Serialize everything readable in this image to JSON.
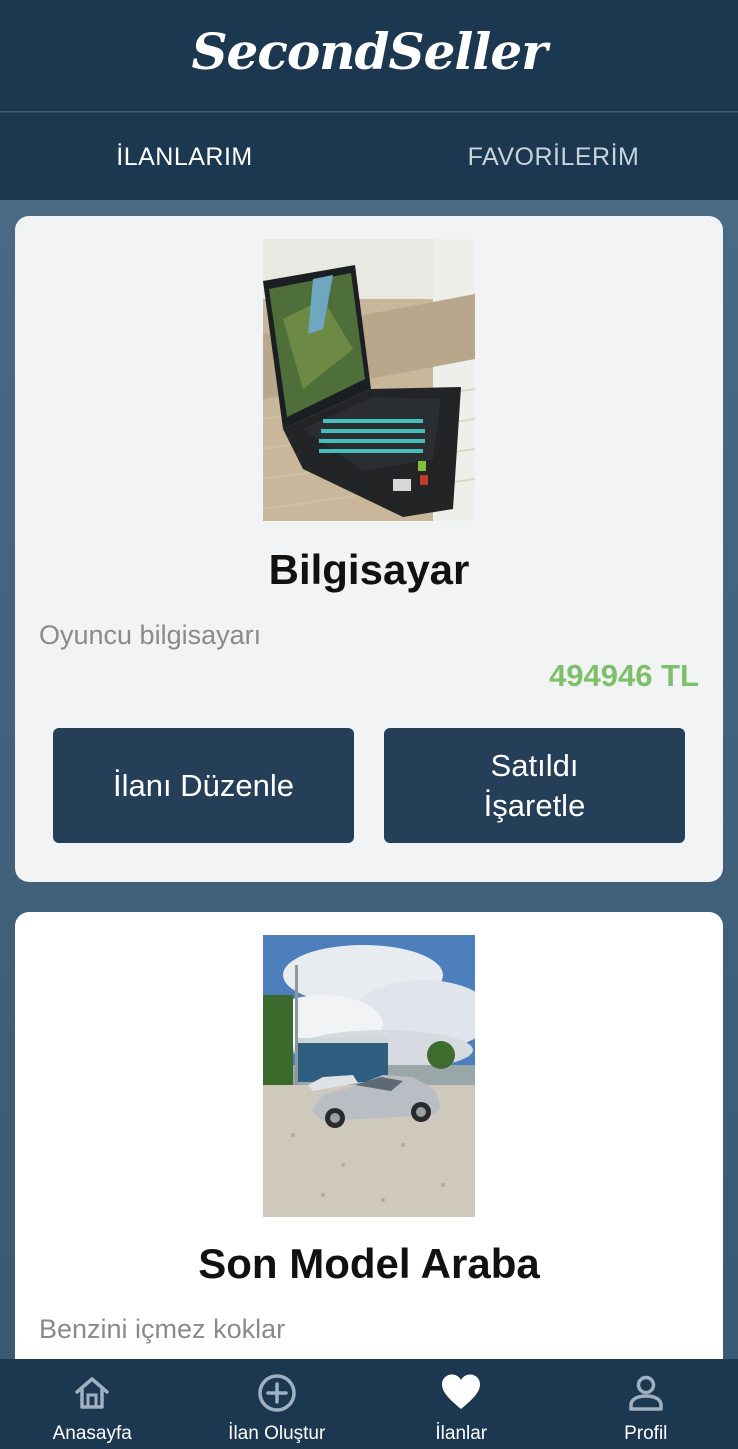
{
  "header": {
    "brand": "SecondSeller"
  },
  "tabs": [
    {
      "label": "İLANLARIM",
      "active": true
    },
    {
      "label": "FAVORİLERİM",
      "active": false
    }
  ],
  "listings": [
    {
      "title": "Bilgisayar",
      "description": "Oyuncu bilgisayarı",
      "price": "494946 TL",
      "edit_label": "İlanı Düzenle",
      "sold_label_line1": "Satıldı",
      "sold_label_line2": "İşaretle",
      "image": "laptop-photo"
    },
    {
      "title": "Son Model Araba",
      "description": "Benzini içmez koklar",
      "image": "car-photo"
    }
  ],
  "bottom_nav": [
    {
      "label": "Anasayfa",
      "icon": "home-icon"
    },
    {
      "label": "İlan Oluştur",
      "icon": "add-circle-icon"
    },
    {
      "label": "İlanlar",
      "icon": "heart-icon",
      "active": true
    },
    {
      "label": "Profil",
      "icon": "person-icon"
    }
  ],
  "colors": {
    "primary": "#1c3750",
    "button": "#243f57",
    "price": "#7fbf6a",
    "background": "#3f5f79"
  }
}
